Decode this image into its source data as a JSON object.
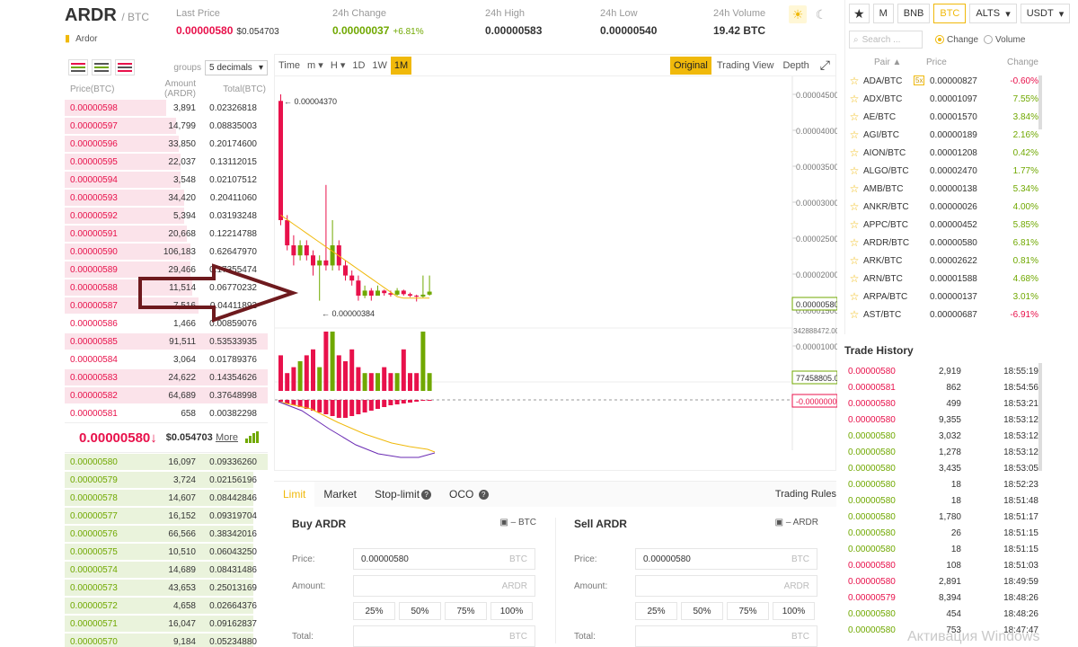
{
  "header": {
    "pair": "ARDR",
    "quote": "/ BTC",
    "coin_name": "Ardor",
    "stats": [
      {
        "label": "Last Price",
        "value": "0.00000580",
        "sub": "$0.054703",
        "tone": "neg"
      },
      {
        "label": "24h Change",
        "value": "0.00000037",
        "sub": "+6.81%",
        "tone": "pos"
      },
      {
        "label": "24h High",
        "value": "0.00000583",
        "sub": "",
        "tone": ""
      },
      {
        "label": "24h Low",
        "value": "0.00000540",
        "sub": "",
        "tone": ""
      },
      {
        "label": "24h Volume",
        "value": "19.42 BTC",
        "sub": "",
        "tone": ""
      }
    ],
    "icons": {
      "light": "sun-icon",
      "dark": "moon-icon"
    }
  },
  "orderbook": {
    "groups_label": "groups",
    "groups_value": "5 decimals",
    "columns": [
      "Price(BTC)",
      "Amount (ARDR)",
      "Total(BTC)"
    ],
    "asks": [
      {
        "price": "0.00000598",
        "amount": "3,891",
        "total": "0.02326818",
        "depth": 0.5
      },
      {
        "price": "0.00000597",
        "amount": "14,799",
        "total": "0.08835003",
        "depth": 0.55
      },
      {
        "price": "0.00000596",
        "amount": "33,850",
        "total": "0.20174600",
        "depth": 0.56
      },
      {
        "price": "0.00000595",
        "amount": "22,037",
        "total": "0.13112015",
        "depth": 0.57
      },
      {
        "price": "0.00000594",
        "amount": "3,548",
        "total": "0.02107512",
        "depth": 0.57
      },
      {
        "price": "0.00000593",
        "amount": "34,420",
        "total": "0.20411060",
        "depth": 0.59
      },
      {
        "price": "0.00000592",
        "amount": "5,394",
        "total": "0.03193248",
        "depth": 0.59
      },
      {
        "price": "0.00000591",
        "amount": "20,668",
        "total": "0.12214788",
        "depth": 0.6
      },
      {
        "price": "0.00000590",
        "amount": "106,183",
        "total": "0.62647970",
        "depth": 0.62
      },
      {
        "price": "0.00000589",
        "amount": "29,466",
        "total": "0.17355474",
        "depth": 0.62
      },
      {
        "price": "0.00000588",
        "amount": "11,514",
        "total": "0.06770232",
        "depth": 0.63
      },
      {
        "price": "0.00000587",
        "amount": "7,516",
        "total": "0.04411892",
        "depth": 0.66
      },
      {
        "price": "0.00000586",
        "amount": "1,466",
        "total": "0.00859076",
        "depth": 0.0
      },
      {
        "price": "0.00000585",
        "amount": "91,511",
        "total": "0.53533935",
        "depth": 1.0
      },
      {
        "price": "0.00000584",
        "amount": "3,064",
        "total": "0.01789376",
        "depth": 0.0
      },
      {
        "price": "0.00000583",
        "amount": "24,622",
        "total": "0.14354626",
        "depth": 1.0
      },
      {
        "price": "0.00000582",
        "amount": "64,689",
        "total": "0.37648998",
        "depth": 1.0
      },
      {
        "price": "0.00000581",
        "amount": "658",
        "total": "0.00382298",
        "depth": 0.0
      }
    ],
    "last_price": "0.00000580↓",
    "last_usd": "$0.054703",
    "more_label": "More",
    "bids": [
      {
        "price": "0.00000580",
        "amount": "16,097",
        "total": "0.09336260",
        "depth": 1.0
      },
      {
        "price": "0.00000579",
        "amount": "3,724",
        "total": "0.02156196",
        "depth": 0.93
      },
      {
        "price": "0.00000578",
        "amount": "14,607",
        "total": "0.08442846",
        "depth": 0.93
      },
      {
        "price": "0.00000577",
        "amount": "16,152",
        "total": "0.09319704",
        "depth": 0.93
      },
      {
        "price": "0.00000576",
        "amount": "66,566",
        "total": "0.38342016",
        "depth": 0.93
      },
      {
        "price": "0.00000575",
        "amount": "10,510",
        "total": "0.06043250",
        "depth": 0.93
      },
      {
        "price": "0.00000574",
        "amount": "14,689",
        "total": "0.08431486",
        "depth": 0.93
      },
      {
        "price": "0.00000573",
        "amount": "43,653",
        "total": "0.25013169",
        "depth": 0.93
      },
      {
        "price": "0.00000572",
        "amount": "4,658",
        "total": "0.02664376",
        "depth": 0.93
      },
      {
        "price": "0.00000571",
        "amount": "16,047",
        "total": "0.09162837",
        "depth": 0.93
      },
      {
        "price": "0.00000570",
        "amount": "9,184",
        "total": "0.05234880",
        "depth": 0.93
      }
    ]
  },
  "chart": {
    "toolbar_left": [
      "Time",
      "m",
      "H",
      "1D",
      "1W",
      "1M"
    ],
    "active_interval": "1M",
    "toolbar_right": [
      "Original",
      "Trading View",
      "Depth"
    ],
    "active_view": "Original",
    "y_ticks": [
      "0.00004500",
      "0.00004000",
      "0.00003500",
      "0.00003000",
      "0.00002500",
      "0.00002000",
      "0.00001500",
      "0.00001000"
    ],
    "current_price_tag": "0.00000580",
    "high_label": "0.00004370",
    "low_label": "0.00000384",
    "volume_scale": "342888472.00",
    "volume_tag": "77458805.00",
    "macd_tag": "-0.0000000"
  },
  "trade_form": {
    "tabs": [
      "Limit",
      "Market",
      "Stop-limit",
      "OCO"
    ],
    "active_tab": "Limit",
    "rules": "Trading Rules",
    "buy": {
      "title": "Buy ARDR",
      "wallet": "– BTC",
      "price": "0.00000580",
      "price_unit": "BTC",
      "amount_unit": "ARDR",
      "total_unit": "BTC"
    },
    "sell": {
      "title": "Sell ARDR",
      "wallet": "– ARDR",
      "price": "0.00000580",
      "price_unit": "BTC",
      "amount_unit": "ARDR",
      "total_unit": "BTC"
    },
    "labels": {
      "price": "Price:",
      "amount": "Amount:",
      "total": "Total:"
    },
    "percents": [
      "25%",
      "50%",
      "75%",
      "100%"
    ]
  },
  "market": {
    "tabs": [
      "M",
      "BNB",
      "BTC",
      "ALTS",
      "USDT"
    ],
    "active_tab": "BTC",
    "search_placeholder": "Search ...",
    "radio": [
      "Change",
      "Volume"
    ],
    "columns": [
      "Pair ▲",
      "Price",
      "Change"
    ],
    "rows": [
      {
        "pair": "ADA/BTC",
        "price": "0.00000827",
        "change": "-0.60%",
        "lev": "5x"
      },
      {
        "pair": "ADX/BTC",
        "price": "0.00001097",
        "change": "7.55%",
        "lev": ""
      },
      {
        "pair": "AE/BTC",
        "price": "0.00001570",
        "change": "3.84%",
        "lev": ""
      },
      {
        "pair": "AGI/BTC",
        "price": "0.00000189",
        "change": "2.16%",
        "lev": ""
      },
      {
        "pair": "AION/BTC",
        "price": "0.00001208",
        "change": "0.42%",
        "lev": ""
      },
      {
        "pair": "ALGO/BTC",
        "price": "0.00002470",
        "change": "1.77%",
        "lev": ""
      },
      {
        "pair": "AMB/BTC",
        "price": "0.00000138",
        "change": "5.34%",
        "lev": ""
      },
      {
        "pair": "ANKR/BTC",
        "price": "0.00000026",
        "change": "4.00%",
        "lev": ""
      },
      {
        "pair": "APPC/BTC",
        "price": "0.00000452",
        "change": "5.85%",
        "lev": ""
      },
      {
        "pair": "ARDR/BTC",
        "price": "0.00000580",
        "change": "6.81%",
        "lev": ""
      },
      {
        "pair": "ARK/BTC",
        "price": "0.00002622",
        "change": "0.81%",
        "lev": ""
      },
      {
        "pair": "ARN/BTC",
        "price": "0.00001588",
        "change": "4.68%",
        "lev": ""
      },
      {
        "pair": "ARPA/BTC",
        "price": "0.00000137",
        "change": "3.01%",
        "lev": ""
      },
      {
        "pair": "AST/BTC",
        "price": "0.00000687",
        "change": "-6.91%",
        "lev": ""
      }
    ]
  },
  "history": {
    "title": "Trade History",
    "rows": [
      {
        "price": "0.00000580",
        "amount": "2,919",
        "time": "18:55:19",
        "side": "neg"
      },
      {
        "price": "0.00000581",
        "amount": "862",
        "time": "18:54:56",
        "side": "neg"
      },
      {
        "price": "0.00000580",
        "amount": "499",
        "time": "18:53:21",
        "side": "neg"
      },
      {
        "price": "0.00000580",
        "amount": "9,355",
        "time": "18:53:12",
        "side": "neg"
      },
      {
        "price": "0.00000580",
        "amount": "3,032",
        "time": "18:53:12",
        "side": "pos"
      },
      {
        "price": "0.00000580",
        "amount": "1,278",
        "time": "18:53:12",
        "side": "pos"
      },
      {
        "price": "0.00000580",
        "amount": "3,435",
        "time": "18:53:05",
        "side": "pos"
      },
      {
        "price": "0.00000580",
        "amount": "18",
        "time": "18:52:23",
        "side": "pos"
      },
      {
        "price": "0.00000580",
        "amount": "18",
        "time": "18:51:48",
        "side": "pos"
      },
      {
        "price": "0.00000580",
        "amount": "1,780",
        "time": "18:51:17",
        "side": "pos"
      },
      {
        "price": "0.00000580",
        "amount": "26",
        "time": "18:51:15",
        "side": "pos"
      },
      {
        "price": "0.00000580",
        "amount": "18",
        "time": "18:51:15",
        "side": "pos"
      },
      {
        "price": "0.00000580",
        "amount": "108",
        "time": "18:51:03",
        "side": "neg"
      },
      {
        "price": "0.00000580",
        "amount": "2,891",
        "time": "18:49:59",
        "side": "neg"
      },
      {
        "price": "0.00000579",
        "amount": "8,394",
        "time": "18:48:26",
        "side": "neg"
      },
      {
        "price": "0.00000580",
        "amount": "454",
        "time": "18:48:26",
        "side": "pos"
      },
      {
        "price": "0.00000580",
        "amount": "753",
        "time": "18:47:47",
        "side": "pos"
      }
    ]
  },
  "watermark": "Активация Windows",
  "colors": {
    "red": "#e8114b",
    "green": "#70a800",
    "accent": "#f0b90b",
    "arrow": "#6e1a1e"
  }
}
